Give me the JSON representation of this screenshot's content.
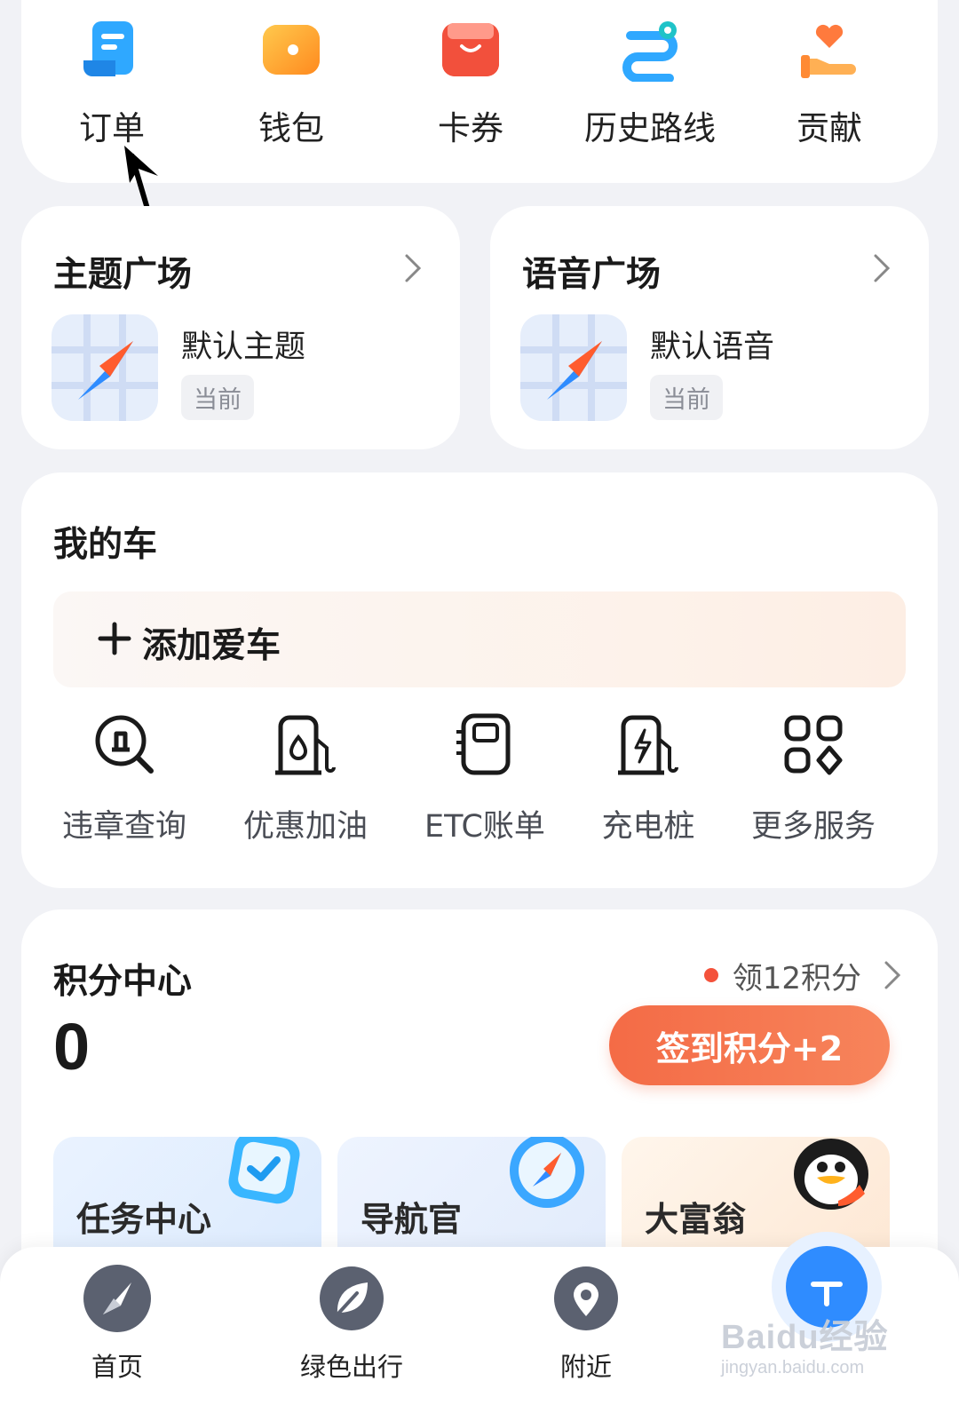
{
  "shortcuts": [
    {
      "label": "订单",
      "icon": "order-scroll-icon"
    },
    {
      "label": "钱包",
      "icon": "wallet-icon"
    },
    {
      "label": "卡券",
      "icon": "coupon-icon"
    },
    {
      "label": "历史路线",
      "icon": "route-icon"
    },
    {
      "label": "贡献",
      "icon": "contribute-heart-hand-icon"
    }
  ],
  "theme_card": {
    "title": "主题广场",
    "item_name": "默认主题",
    "tag": "当前"
  },
  "voice_card": {
    "title": "语音广场",
    "item_name": "默认语音",
    "tag": "当前"
  },
  "my_car": {
    "title": "我的车",
    "add_car_label": "添加爱车",
    "services": [
      {
        "label": "违章查询",
        "icon": "violation-search-icon"
      },
      {
        "label": "优惠加油",
        "icon": "fuel-pump-icon"
      },
      {
        "label": "ETC账单",
        "icon": "etc-card-icon"
      },
      {
        "label": "充电桩",
        "icon": "charging-pile-icon"
      },
      {
        "label": "更多服务",
        "icon": "more-services-icon"
      }
    ]
  },
  "points": {
    "title": "积分中心",
    "claim_link": "领12积分",
    "value": "0",
    "checkin_button": "签到积分+2",
    "tiles": [
      {
        "label": "任务中心",
        "icon": "task-check-icon"
      },
      {
        "label": "导航官",
        "icon": "compass-icon"
      },
      {
        "label": "大富翁",
        "icon": "penguin-icon"
      }
    ]
  },
  "bottom_nav": [
    {
      "label": "首页",
      "icon": "home-compass-icon"
    },
    {
      "label": "绿色出行",
      "icon": "leaf-icon"
    },
    {
      "label": "附近",
      "icon": "location-pin-icon"
    },
    {
      "label": "",
      "icon": "profile-icon"
    }
  ],
  "watermark": {
    "brand": "Baidu经验",
    "url": "jingyan.baidu.com"
  },
  "colors": {
    "accent_orange": "#f46b46",
    "icon_blue": "#2f8cff",
    "dot_red": "#f4523b"
  }
}
